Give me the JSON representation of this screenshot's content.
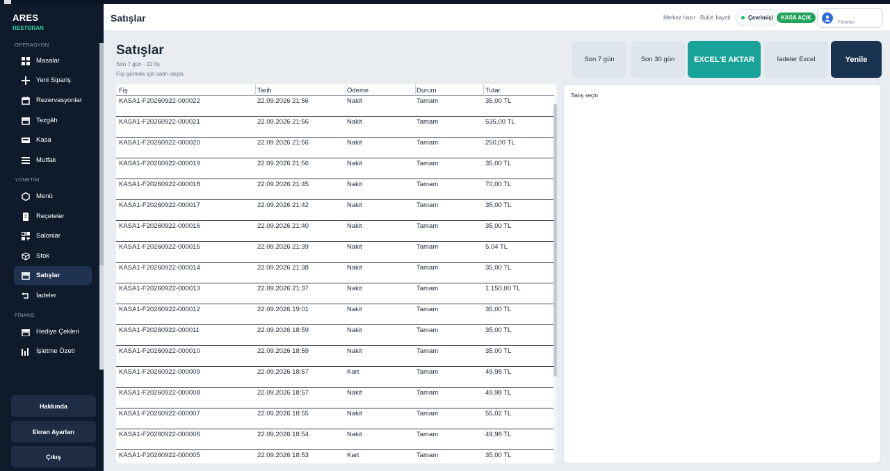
{
  "app": {
    "brand": "ARES",
    "brand_sub": "RESTORAN"
  },
  "sidebar": {
    "sections": [
      {
        "title": "OPERASYON",
        "items": [
          {
            "label": "Masalar",
            "icon": "grid-icon"
          },
          {
            "label": "Yeni Sipariş",
            "icon": "plus-icon"
          },
          {
            "label": "Rezervasyonlar",
            "icon": "calendar-icon"
          },
          {
            "label": "Tezgâh",
            "icon": "store-icon"
          },
          {
            "label": "Kasa",
            "icon": "cash-register-icon"
          },
          {
            "label": "Mutfak",
            "icon": "menu-lines-icon"
          }
        ]
      },
      {
        "title": "YÖNETİM",
        "items": [
          {
            "label": "Menü",
            "icon": "hexagon-icon"
          },
          {
            "label": "Reçeteler",
            "icon": "document-icon"
          },
          {
            "label": "Salonlar",
            "icon": "layout-icon"
          },
          {
            "label": "Stok",
            "icon": "box-icon"
          },
          {
            "label": "Satışlar",
            "icon": "store-icon",
            "active": true
          },
          {
            "label": "İadeler",
            "icon": "return-icon"
          }
        ]
      },
      {
        "title": "FİNANS",
        "items": [
          {
            "label": "Hediye Çekleri",
            "icon": "gift-icon"
          },
          {
            "label": "İşletme Özeti",
            "icon": "bar-chart-icon"
          }
        ]
      }
    ],
    "bottom_buttons": [
      "Hakkında",
      "Ekran Ayarları",
      "Çıkış"
    ]
  },
  "header": {
    "title": "Satışlar",
    "status_center": "Merkez hazır",
    "status_cloud": "Bulut: kayıtlı",
    "online": "Çevrimiçi",
    "kasa": "KASA AÇIK",
    "user_role": "Yönetici"
  },
  "page": {
    "title": "Satışlar",
    "subtitle": "Son 7 gün · 22 fiş",
    "hint": "Fişi görmek için satırı seçin."
  },
  "toolbar": {
    "last7": "Son 7 gün",
    "last30": "Son 30 gün",
    "excel": "EXCEL'E AKTAR",
    "returns_excel": "İadeler Excel",
    "refresh": "Yenile"
  },
  "table": {
    "columns": [
      "Fiş",
      "Tarih",
      "Ödeme",
      "Durum",
      "Tutar"
    ],
    "rows": [
      [
        "KASA1-F20260922-000022",
        "22.09.2026 21:56",
        "Nakit",
        "Tamam",
        "35,00 TL"
      ],
      [
        "KASA1-F20260922-000021",
        "22.09.2026 21:56",
        "Nakit",
        "Tamam",
        "535,00 TL"
      ],
      [
        "KASA1-F20260922-000020",
        "22.09.2026 21:56",
        "Nakit",
        "Tamam",
        "250,00 TL"
      ],
      [
        "KASA1-F20260922-000019",
        "22.09.2026 21:56",
        "Nakit",
        "Tamam",
        "35,00 TL"
      ],
      [
        "KASA1-F20260922-000018",
        "22.09.2026 21:45",
        "Nakit",
        "Tamam",
        "70,00 TL"
      ],
      [
        "KASA1-F20260922-000017",
        "22.09.2026 21:42",
        "Nakit",
        "Tamam",
        "35,00 TL"
      ],
      [
        "KASA1-F20260922-000016",
        "22.09.2026 21:40",
        "Nakit",
        "Tamam",
        "35,00 TL"
      ],
      [
        "KASA1-F20260922-000015",
        "22.09.2026 21:39",
        "Nakit",
        "Tamam",
        "5,04 TL"
      ],
      [
        "KASA1-F20260922-000014",
        "22.09.2026 21:38",
        "Nakit",
        "Tamam",
        "35,00 TL"
      ],
      [
        "KASA1-F20260922-000013",
        "22.09.2026 21:37",
        "Nakit",
        "Tamam",
        "1.150,00 TL"
      ],
      [
        "KASA1-F20260922-000012",
        "22.09.2026 19:01",
        "Nakit",
        "Tamam",
        "35,00 TL"
      ],
      [
        "KASA1-F20260922-000011",
        "22.09.2026 18:59",
        "Nakit",
        "Tamam",
        "35,00 TL"
      ],
      [
        "KASA1-F20260922-000010",
        "22.09.2026 18:59",
        "Nakit",
        "Tamam",
        "35,00 TL"
      ],
      [
        "KASA1-F20260922-000009",
        "22.09.2026 18:57",
        "Kart",
        "Tamam",
        "49,98 TL"
      ],
      [
        "KASA1-F20260922-000008",
        "22.09.2026 18:57",
        "Nakit",
        "Tamam",
        "49,98 TL"
      ],
      [
        "KASA1-F20260922-000007",
        "22.09.2026 18:55",
        "Nakit",
        "Tamam",
        "55,02 TL"
      ],
      [
        "KASA1-F20260922-000006",
        "22.09.2026 18:54",
        "Nakit",
        "Tamam",
        "49,98 TL"
      ],
      [
        "KASA1-F20260922-000005",
        "22.09.2026 18:53",
        "Kart",
        "Tamam",
        "35,00 TL"
      ]
    ]
  },
  "detail": {
    "placeholder": "Satış seçin"
  },
  "colors": {
    "sidebar_bg": "#0f1a2b",
    "accent_teal": "#17a39a",
    "brand_sub": "#2fd3a8",
    "kasa_green": "#22a35a",
    "refresh_dark": "#1a3350"
  }
}
